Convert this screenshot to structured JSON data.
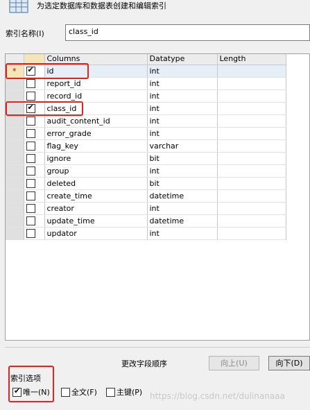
{
  "header": {
    "title": "为选定数据库和数据表创建和编辑索引",
    "icon": "database-table-icon"
  },
  "index_name": {
    "label": "索引名称(I)",
    "value": "class_id"
  },
  "grid": {
    "headers": {
      "columns": "Columns",
      "datatype": "Datatype",
      "length": "Length"
    },
    "active_marker": "*",
    "rows": [
      {
        "column": "id",
        "datatype": "int",
        "length": "",
        "checked": true
      },
      {
        "column": "report_id",
        "datatype": "int",
        "length": "",
        "checked": false
      },
      {
        "column": "record_id",
        "datatype": "int",
        "length": "",
        "checked": false
      },
      {
        "column": "class_id",
        "datatype": "int",
        "length": "",
        "checked": true
      },
      {
        "column": "audit_content_id",
        "datatype": "int",
        "length": "",
        "checked": false
      },
      {
        "column": "error_grade",
        "datatype": "int",
        "length": "",
        "checked": false
      },
      {
        "column": "flag_key",
        "datatype": "varchar",
        "length": "",
        "checked": false
      },
      {
        "column": "ignore",
        "datatype": "bit",
        "length": "",
        "checked": false
      },
      {
        "column": "group",
        "datatype": "int",
        "length": "",
        "checked": false
      },
      {
        "column": "deleted",
        "datatype": "bit",
        "length": "",
        "checked": false
      },
      {
        "column": "create_time",
        "datatype": "datetime",
        "length": "",
        "checked": false
      },
      {
        "column": "creator",
        "datatype": "int",
        "length": "",
        "checked": false
      },
      {
        "column": "update_time",
        "datatype": "datetime",
        "length": "",
        "checked": false
      },
      {
        "column": "updator",
        "datatype": "int",
        "length": "",
        "checked": false
      }
    ]
  },
  "order": {
    "label": "更改字段顺序",
    "up_label": "向上(U)",
    "down_label": "向下(D)"
  },
  "options": {
    "label": "索引选项",
    "unique": {
      "label": "唯一(N)",
      "checked": true
    },
    "fulltext": {
      "label": "全文(F)",
      "checked": false
    },
    "primary": {
      "label": "主键(P)",
      "checked": false
    }
  },
  "watermark": "https://blog.csdn.net/dulinanaaa",
  "colors": {
    "highlight_box": "#e8221b",
    "selected_row": "#e6eef8",
    "active_marker": "#f4e6b8"
  }
}
